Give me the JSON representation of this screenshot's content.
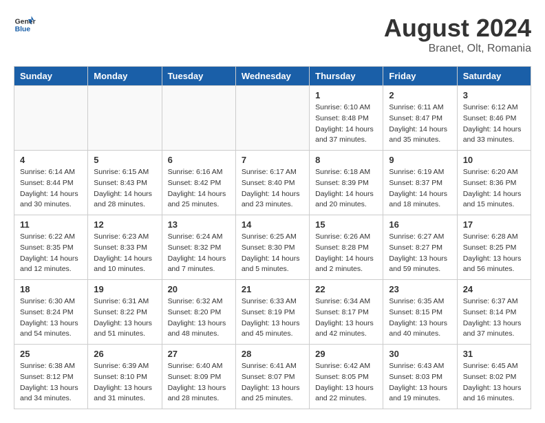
{
  "header": {
    "logo_general": "General",
    "logo_blue": "Blue",
    "month_year": "August 2024",
    "location": "Branet, Olt, Romania"
  },
  "weekdays": [
    "Sunday",
    "Monday",
    "Tuesday",
    "Wednesday",
    "Thursday",
    "Friday",
    "Saturday"
  ],
  "weeks": [
    [
      {
        "day": "",
        "info": ""
      },
      {
        "day": "",
        "info": ""
      },
      {
        "day": "",
        "info": ""
      },
      {
        "day": "",
        "info": ""
      },
      {
        "day": "1",
        "info": "Sunrise: 6:10 AM\nSunset: 8:48 PM\nDaylight: 14 hours\nand 37 minutes."
      },
      {
        "day": "2",
        "info": "Sunrise: 6:11 AM\nSunset: 8:47 PM\nDaylight: 14 hours\nand 35 minutes."
      },
      {
        "day": "3",
        "info": "Sunrise: 6:12 AM\nSunset: 8:46 PM\nDaylight: 14 hours\nand 33 minutes."
      }
    ],
    [
      {
        "day": "4",
        "info": "Sunrise: 6:14 AM\nSunset: 8:44 PM\nDaylight: 14 hours\nand 30 minutes."
      },
      {
        "day": "5",
        "info": "Sunrise: 6:15 AM\nSunset: 8:43 PM\nDaylight: 14 hours\nand 28 minutes."
      },
      {
        "day": "6",
        "info": "Sunrise: 6:16 AM\nSunset: 8:42 PM\nDaylight: 14 hours\nand 25 minutes."
      },
      {
        "day": "7",
        "info": "Sunrise: 6:17 AM\nSunset: 8:40 PM\nDaylight: 14 hours\nand 23 minutes."
      },
      {
        "day": "8",
        "info": "Sunrise: 6:18 AM\nSunset: 8:39 PM\nDaylight: 14 hours\nand 20 minutes."
      },
      {
        "day": "9",
        "info": "Sunrise: 6:19 AM\nSunset: 8:37 PM\nDaylight: 14 hours\nand 18 minutes."
      },
      {
        "day": "10",
        "info": "Sunrise: 6:20 AM\nSunset: 8:36 PM\nDaylight: 14 hours\nand 15 minutes."
      }
    ],
    [
      {
        "day": "11",
        "info": "Sunrise: 6:22 AM\nSunset: 8:35 PM\nDaylight: 14 hours\nand 12 minutes."
      },
      {
        "day": "12",
        "info": "Sunrise: 6:23 AM\nSunset: 8:33 PM\nDaylight: 14 hours\nand 10 minutes."
      },
      {
        "day": "13",
        "info": "Sunrise: 6:24 AM\nSunset: 8:32 PM\nDaylight: 14 hours\nand 7 minutes."
      },
      {
        "day": "14",
        "info": "Sunrise: 6:25 AM\nSunset: 8:30 PM\nDaylight: 14 hours\nand 5 minutes."
      },
      {
        "day": "15",
        "info": "Sunrise: 6:26 AM\nSunset: 8:28 PM\nDaylight: 14 hours\nand 2 minutes."
      },
      {
        "day": "16",
        "info": "Sunrise: 6:27 AM\nSunset: 8:27 PM\nDaylight: 13 hours\nand 59 minutes."
      },
      {
        "day": "17",
        "info": "Sunrise: 6:28 AM\nSunset: 8:25 PM\nDaylight: 13 hours\nand 56 minutes."
      }
    ],
    [
      {
        "day": "18",
        "info": "Sunrise: 6:30 AM\nSunset: 8:24 PM\nDaylight: 13 hours\nand 54 minutes."
      },
      {
        "day": "19",
        "info": "Sunrise: 6:31 AM\nSunset: 8:22 PM\nDaylight: 13 hours\nand 51 minutes."
      },
      {
        "day": "20",
        "info": "Sunrise: 6:32 AM\nSunset: 8:20 PM\nDaylight: 13 hours\nand 48 minutes."
      },
      {
        "day": "21",
        "info": "Sunrise: 6:33 AM\nSunset: 8:19 PM\nDaylight: 13 hours\nand 45 minutes."
      },
      {
        "day": "22",
        "info": "Sunrise: 6:34 AM\nSunset: 8:17 PM\nDaylight: 13 hours\nand 42 minutes."
      },
      {
        "day": "23",
        "info": "Sunrise: 6:35 AM\nSunset: 8:15 PM\nDaylight: 13 hours\nand 40 minutes."
      },
      {
        "day": "24",
        "info": "Sunrise: 6:37 AM\nSunset: 8:14 PM\nDaylight: 13 hours\nand 37 minutes."
      }
    ],
    [
      {
        "day": "25",
        "info": "Sunrise: 6:38 AM\nSunset: 8:12 PM\nDaylight: 13 hours\nand 34 minutes."
      },
      {
        "day": "26",
        "info": "Sunrise: 6:39 AM\nSunset: 8:10 PM\nDaylight: 13 hours\nand 31 minutes."
      },
      {
        "day": "27",
        "info": "Sunrise: 6:40 AM\nSunset: 8:09 PM\nDaylight: 13 hours\nand 28 minutes."
      },
      {
        "day": "28",
        "info": "Sunrise: 6:41 AM\nSunset: 8:07 PM\nDaylight: 13 hours\nand 25 minutes."
      },
      {
        "day": "29",
        "info": "Sunrise: 6:42 AM\nSunset: 8:05 PM\nDaylight: 13 hours\nand 22 minutes."
      },
      {
        "day": "30",
        "info": "Sunrise: 6:43 AM\nSunset: 8:03 PM\nDaylight: 13 hours\nand 19 minutes."
      },
      {
        "day": "31",
        "info": "Sunrise: 6:45 AM\nSunset: 8:02 PM\nDaylight: 13 hours\nand 16 minutes."
      }
    ]
  ]
}
